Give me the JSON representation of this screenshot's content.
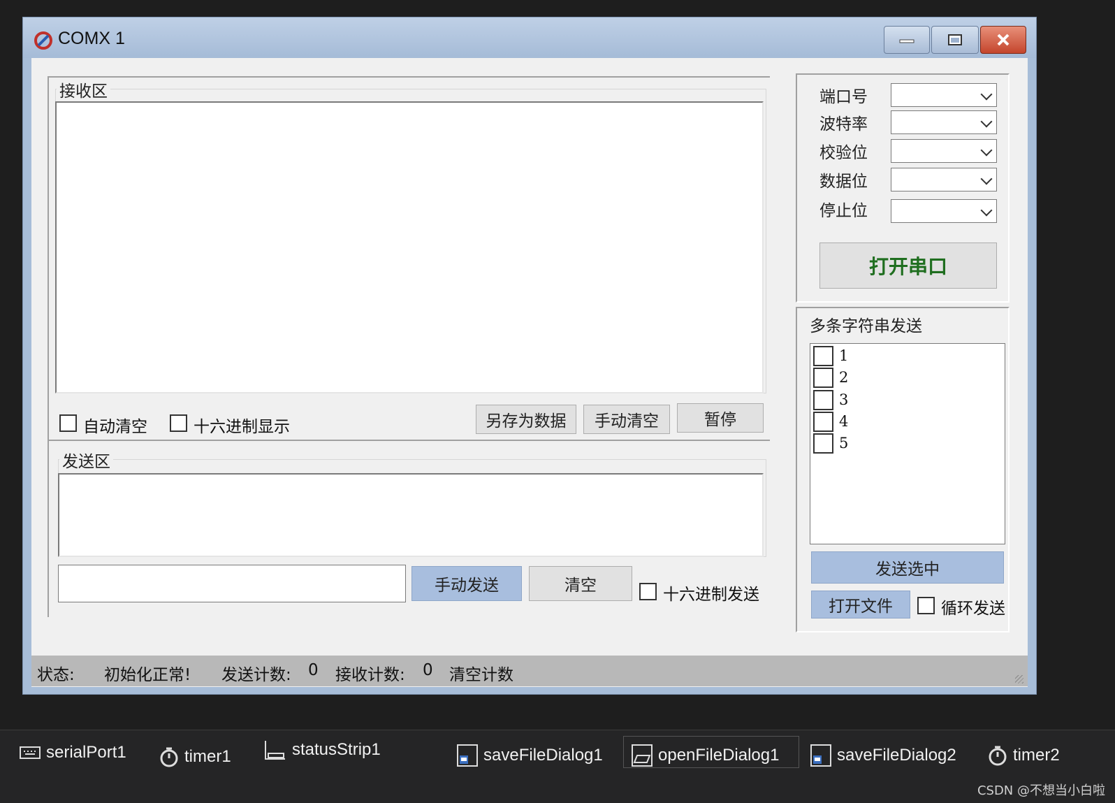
{
  "window": {
    "title": "COMX 1"
  },
  "receive": {
    "legend": "接收区",
    "auto_clear_label": "自动清空",
    "hex_display_label": "十六进制显示",
    "save_button": "另存为数据",
    "clear_button": "手动清空",
    "pause_button": "暂停"
  },
  "send": {
    "legend": "发送区",
    "send_button": "手动发送",
    "clear_button": "清空",
    "hex_send_label": "十六进制发送"
  },
  "config": {
    "port_label": "端口号",
    "baud_label": "波特率",
    "parity_label": "校验位",
    "databits_label": "数据位",
    "stopbits_label": "停止位",
    "open_button": "打开串口"
  },
  "multi": {
    "legend": "多条字符串发送",
    "items": [
      "1",
      "2",
      "3",
      "4",
      "5"
    ],
    "send_selected_button": "发送选中",
    "open_file_button": "打开文件",
    "loop_send_label": "循环发送"
  },
  "status": {
    "state_label": "状态:",
    "state_value": "初始化正常!",
    "send_count_label": "发送计数:",
    "send_count_value": "0",
    "recv_count_label": "接收计数:",
    "recv_count_value": "0",
    "clear_count_label": "清空计数"
  },
  "tray": {
    "items": [
      "serialPort1",
      "timer1",
      "statusStrip1",
      "saveFileDialog1",
      "openFileDialog1",
      "saveFileDialog2",
      "timer2"
    ]
  },
  "watermark": "CSDN @不想当小白啦"
}
